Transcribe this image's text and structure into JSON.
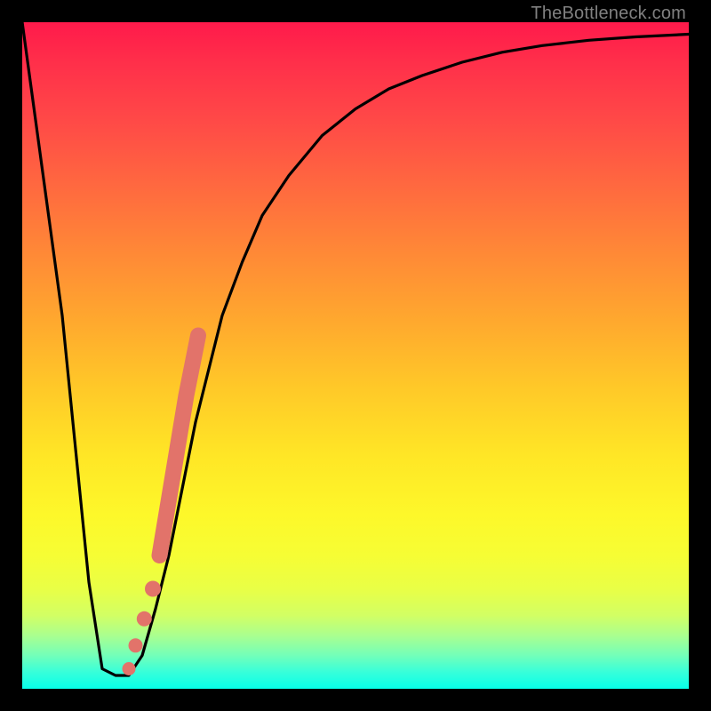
{
  "watermark": "TheBottleneck.com",
  "colors": {
    "frame": "#000000",
    "curve": "#000000",
    "marker_fill": "#e2736a",
    "marker_stroke": "#d45a51",
    "gradient_top": "#ff1a4b",
    "gradient_bottom": "#07ffe9"
  },
  "chart_data": {
    "type": "line",
    "title": "",
    "xlabel": "",
    "ylabel": "",
    "xlim": [
      0,
      100
    ],
    "ylim": [
      0,
      100
    ],
    "grid": false,
    "legend": null,
    "note": "Axes have no tick labels in the source image; x/y values are estimated on a 0–100 normalized scale reading left→right and bottom→top.",
    "series": [
      {
        "name": "bottleneck-curve",
        "x": [
          0,
          3,
          6,
          8,
          10,
          12,
          14,
          16,
          18,
          20,
          22,
          24,
          26,
          28,
          30,
          33,
          36,
          40,
          45,
          50,
          55,
          60,
          66,
          72,
          78,
          85,
          92,
          100
        ],
        "y": [
          100,
          78,
          56,
          36,
          16,
          3,
          2,
          2,
          5,
          12,
          20,
          30,
          40,
          48,
          56,
          64,
          71,
          77,
          83,
          87,
          90,
          92,
          94,
          95.5,
          96.5,
          97.3,
          97.8,
          98.2
        ]
      }
    ],
    "markers": {
      "name": "highlighted-points",
      "style": "thick-rounded-segment-plus-dots",
      "x": [
        16.0,
        17.0,
        18.3,
        19.6,
        20.6,
        21.6,
        22.6,
        23.6,
        24.6,
        25.6,
        26.4
      ],
      "y": [
        3.0,
        6.5,
        10.5,
        15.0,
        20.0,
        26.0,
        32.0,
        38.0,
        44.0,
        49.0,
        53.0
      ]
    }
  }
}
